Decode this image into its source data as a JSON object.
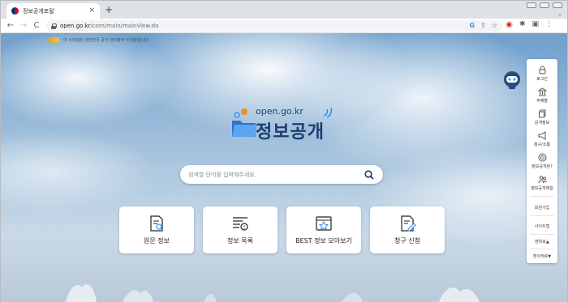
{
  "browser": {
    "tab_title": "정보공개포털",
    "tab_close": "×",
    "new_tab": "+",
    "tab_menu": "⌄",
    "url_host": "open.go.kr",
    "url_path": "/com/main/mainView.do",
    "nav_icons": [
      "back-arrow-icon",
      "forward-arrow-icon",
      "reload-icon"
    ],
    "nav_glyphs": {
      "back": "←",
      "forward": "→",
      "reload": "C"
    },
    "omni_glyphs": {
      "google": "G",
      "share": "⇪",
      "star": "☆"
    },
    "ext_glyphs": {
      "puzzle": "✱",
      "sidepanel": "▣",
      "menu": "⋮"
    }
  },
  "header": {
    "notice": "이 누리집은 대한민국 공식 전자정부 누리집입니다."
  },
  "logo": {
    "url_text": "open.go.kr",
    "name": "정보공개"
  },
  "search": {
    "placeholder": "검색할 단어를 입력해주세요."
  },
  "cards": [
    {
      "label": "원문 정보",
      "icon": "document-search-icon"
    },
    {
      "label": "정보 목록",
      "icon": "list-alert-icon"
    },
    {
      "label": "BEST 정보 모아보기",
      "icon": "best-star-icon"
    },
    {
      "label": "청구 신청",
      "icon": "document-edit-icon"
    }
  ],
  "quick_menu": {
    "items": [
      {
        "label": "로그인",
        "icon": "lock-icon"
      },
      {
        "label": "주제별",
        "icon": "building-icon"
      },
      {
        "label": "공개정보",
        "icon": "copy-icon"
      },
      {
        "label": "청구/소통",
        "icon": "megaphone-icon"
      },
      {
        "label": "정보공개란?",
        "icon": "target-icon"
      },
      {
        "label": "정보공개체험",
        "icon": "people-icon"
      }
    ],
    "links": [
      "회원가입",
      "사이트맵"
    ],
    "scroll_up": "맨위로▲",
    "scroll_down": "맨아래로▼"
  },
  "colors": {
    "brand_navy": "#1c3c72",
    "accent_orange": "#f08a24",
    "accent_blue": "#3a8fe0"
  }
}
